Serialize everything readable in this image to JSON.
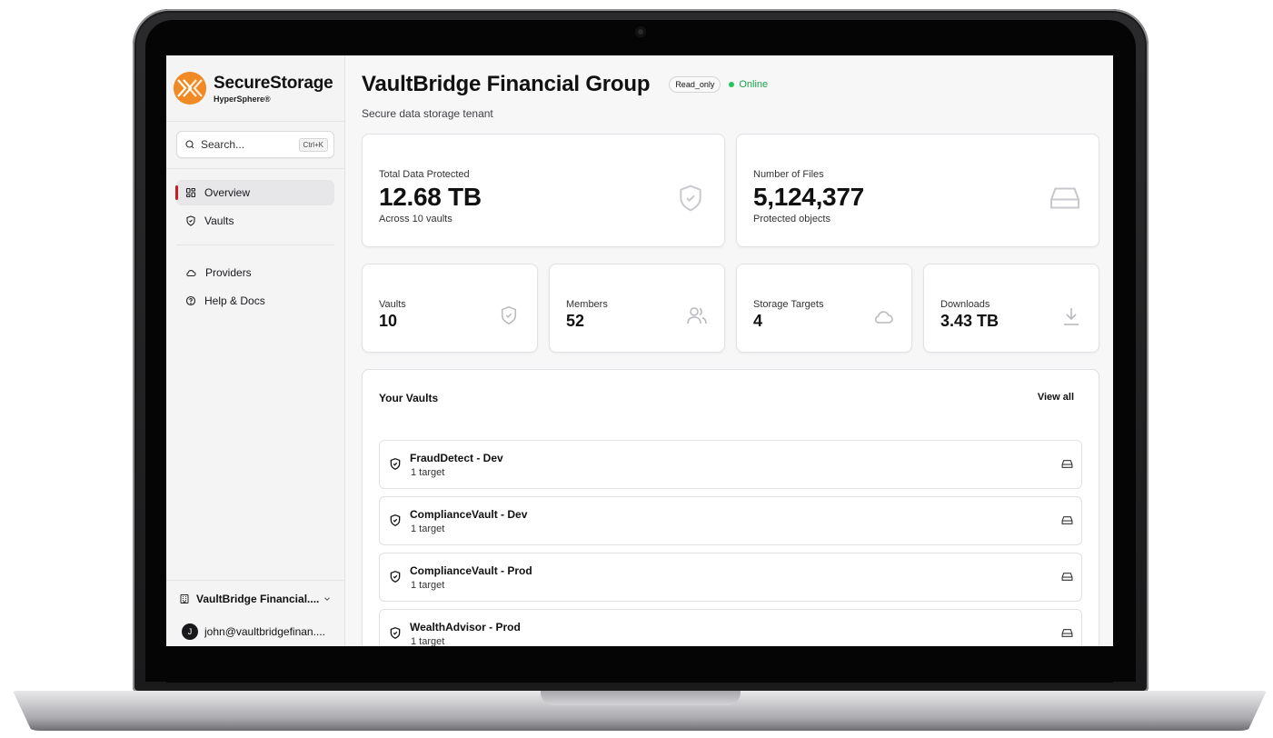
{
  "brand": {
    "name": "SecureStorage",
    "product": "HyperSphere®",
    "color": "#f08a24"
  },
  "search": {
    "placeholder": "Search...",
    "shortcut": "Ctrl+K"
  },
  "nav": {
    "primary": [
      {
        "label": "Overview",
        "icon": "grid-icon",
        "active": true
      },
      {
        "label": "Vaults",
        "icon": "shield-icon",
        "active": false
      }
    ],
    "secondary": [
      {
        "label": "Providers",
        "icon": "cloud-icon"
      },
      {
        "label": "Help & Docs",
        "icon": "help-circle-icon"
      }
    ]
  },
  "footer": {
    "org_name": "VaultBridge Financial....",
    "user_initial": "J",
    "user_email": "john@vaultbridgefinan...."
  },
  "header": {
    "title": "VaultBridge Financial Group",
    "badge": "Read_only",
    "status": "Online",
    "status_color": "#16a34a",
    "subtitle": "Secure data storage tenant"
  },
  "stats_top": [
    {
      "label": "Total Data Protected",
      "value": "12.68 TB",
      "note": "Across 10 vaults",
      "icon": "shield-check-icon"
    },
    {
      "label": "Number of Files",
      "value": "5,124,377",
      "note": "Protected objects",
      "icon": "hard-drive-icon"
    }
  ],
  "stats_small": [
    {
      "label": "Vaults",
      "value": "10",
      "icon": "shield-check-icon"
    },
    {
      "label": "Members",
      "value": "52",
      "icon": "users-icon"
    },
    {
      "label": "Storage Targets",
      "value": "4",
      "icon": "cloud-icon"
    },
    {
      "label": "Downloads",
      "value": "3.43 TB",
      "icon": "download-icon"
    }
  ],
  "vaults": {
    "title": "Your Vaults",
    "view_all": "View all",
    "items": [
      {
        "name": "FraudDetect - Dev",
        "targets": "1 target"
      },
      {
        "name": "ComplianceVault - Dev",
        "targets": "1 target"
      },
      {
        "name": "ComplianceVault - Prod",
        "targets": "1 target"
      },
      {
        "name": "WealthAdvisor - Prod",
        "targets": "1 target"
      }
    ]
  }
}
